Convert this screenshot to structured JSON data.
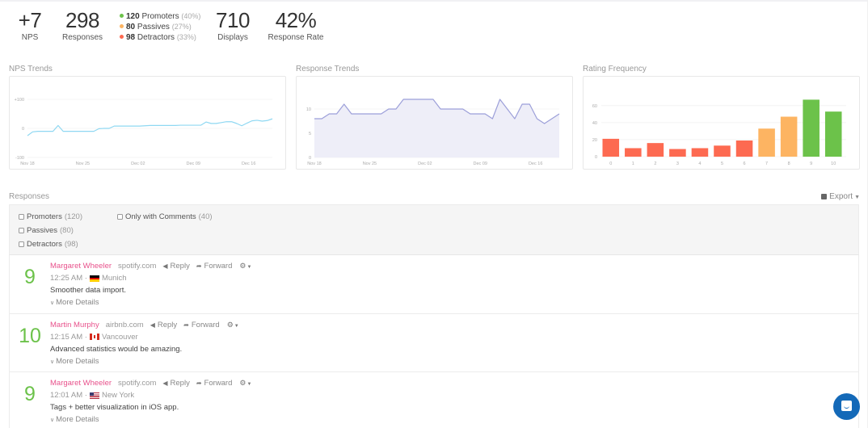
{
  "stats": {
    "nps": {
      "value": "+7",
      "label": "NPS"
    },
    "responses": {
      "value": "298",
      "label": "Responses"
    },
    "breakdown": [
      {
        "count": "120",
        "label": "Promoters",
        "pct": "(40%)",
        "color": "#6cc24a"
      },
      {
        "count": "80",
        "label": "Passives",
        "pct": "(27%)",
        "color": "#fdb462"
      },
      {
        "count": "98",
        "label": "Detractors",
        "pct": "(33%)",
        "color": "#fd6a51"
      }
    ],
    "displays": {
      "value": "710",
      "label": "Displays"
    },
    "response_rate": {
      "value": "42%",
      "label": "Response Rate"
    }
  },
  "chart_data": [
    {
      "type": "line",
      "title": "NPS Trends",
      "color": "#8fd8f2",
      "xlabel": "",
      "ylabel": "",
      "x_ticks": [
        "Nov 18",
        "Nov 25",
        "Dec 02",
        "Dec 09",
        "Dec 16"
      ],
      "y_ticks": [
        "+100",
        "0",
        "-100"
      ],
      "ylim": [
        -100,
        100
      ],
      "grid": true,
      "values": [
        -25,
        -12,
        -10,
        -10,
        -10,
        -10,
        10,
        -10,
        -10,
        -10,
        -10,
        -10,
        -10,
        -10,
        -1,
        0,
        0,
        8,
        8,
        8,
        8,
        8,
        8,
        9,
        10,
        10,
        10,
        10,
        10,
        10,
        11,
        11,
        11,
        11,
        11,
        22,
        17,
        17,
        20,
        23,
        23,
        17,
        9,
        18,
        26,
        28,
        25,
        27,
        33
      ]
    },
    {
      "type": "area",
      "title": "Response Trends",
      "color": "#9c9fd9",
      "fill": "#eeeef8",
      "xlabel": "",
      "ylabel": "",
      "x_ticks": [
        "Nov 18",
        "Nov 25",
        "Dec 02",
        "Dec 09",
        "Dec 16"
      ],
      "y_ticks": [
        "10",
        "5",
        "0"
      ],
      "ylim": [
        0,
        12
      ],
      "grid": true,
      "values": [
        8,
        8,
        9,
        9,
        11,
        9,
        9,
        9,
        9,
        9,
        10,
        10,
        12,
        12,
        12,
        12,
        12,
        10,
        10,
        10,
        10,
        9,
        9,
        9,
        8,
        12,
        10,
        8,
        11,
        11,
        8,
        7,
        8,
        9
      ]
    },
    {
      "type": "bar",
      "title": "Rating Frequency",
      "categories": [
        "0",
        "1",
        "2",
        "3",
        "4",
        "5",
        "6",
        "7",
        "8",
        "9",
        "10"
      ],
      "values": [
        21,
        10,
        16,
        9,
        10,
        13,
        19,
        33,
        47,
        67,
        53
      ],
      "colors": [
        "#fd6a51",
        "#fd6a51",
        "#fd6a51",
        "#fd6a51",
        "#fd6a51",
        "#fd6a51",
        "#fd6a51",
        "#fdb462",
        "#fdb462",
        "#6cc24a",
        "#6cc24a"
      ],
      "y_ticks": [
        "60",
        "40",
        "20",
        "0"
      ],
      "ylim": [
        0,
        75
      ],
      "grid": true
    }
  ],
  "responses": {
    "title": "Responses",
    "export_label": "Export",
    "filters": [
      {
        "label": "Promoters",
        "count": "(120)"
      },
      {
        "label": "Passives",
        "count": "(80)"
      },
      {
        "label": "Detractors",
        "count": "(98)"
      },
      {
        "label": "Only with Comments",
        "count": "(40)"
      }
    ],
    "reply_label": "Reply",
    "forward_label": "Forward",
    "more_label": "More Details",
    "items": [
      {
        "score": "9",
        "name": "Margaret Wheeler",
        "domain": "spotify.com",
        "time": "12:25 AM",
        "flag": "germany",
        "city": "Munich",
        "comment": "Smoother data import."
      },
      {
        "score": "10",
        "name": "Martin Murphy",
        "domain": "airbnb.com",
        "time": "12:15 AM",
        "flag": "canada",
        "city": "Vancouver",
        "comment": "Advanced statistics would be amazing."
      },
      {
        "score": "9",
        "name": "Margaret Wheeler",
        "domain": "spotify.com",
        "time": "12:01 AM",
        "flag": "usa",
        "city": "New York",
        "comment": "Tags + better visualization in iOS app."
      }
    ]
  }
}
